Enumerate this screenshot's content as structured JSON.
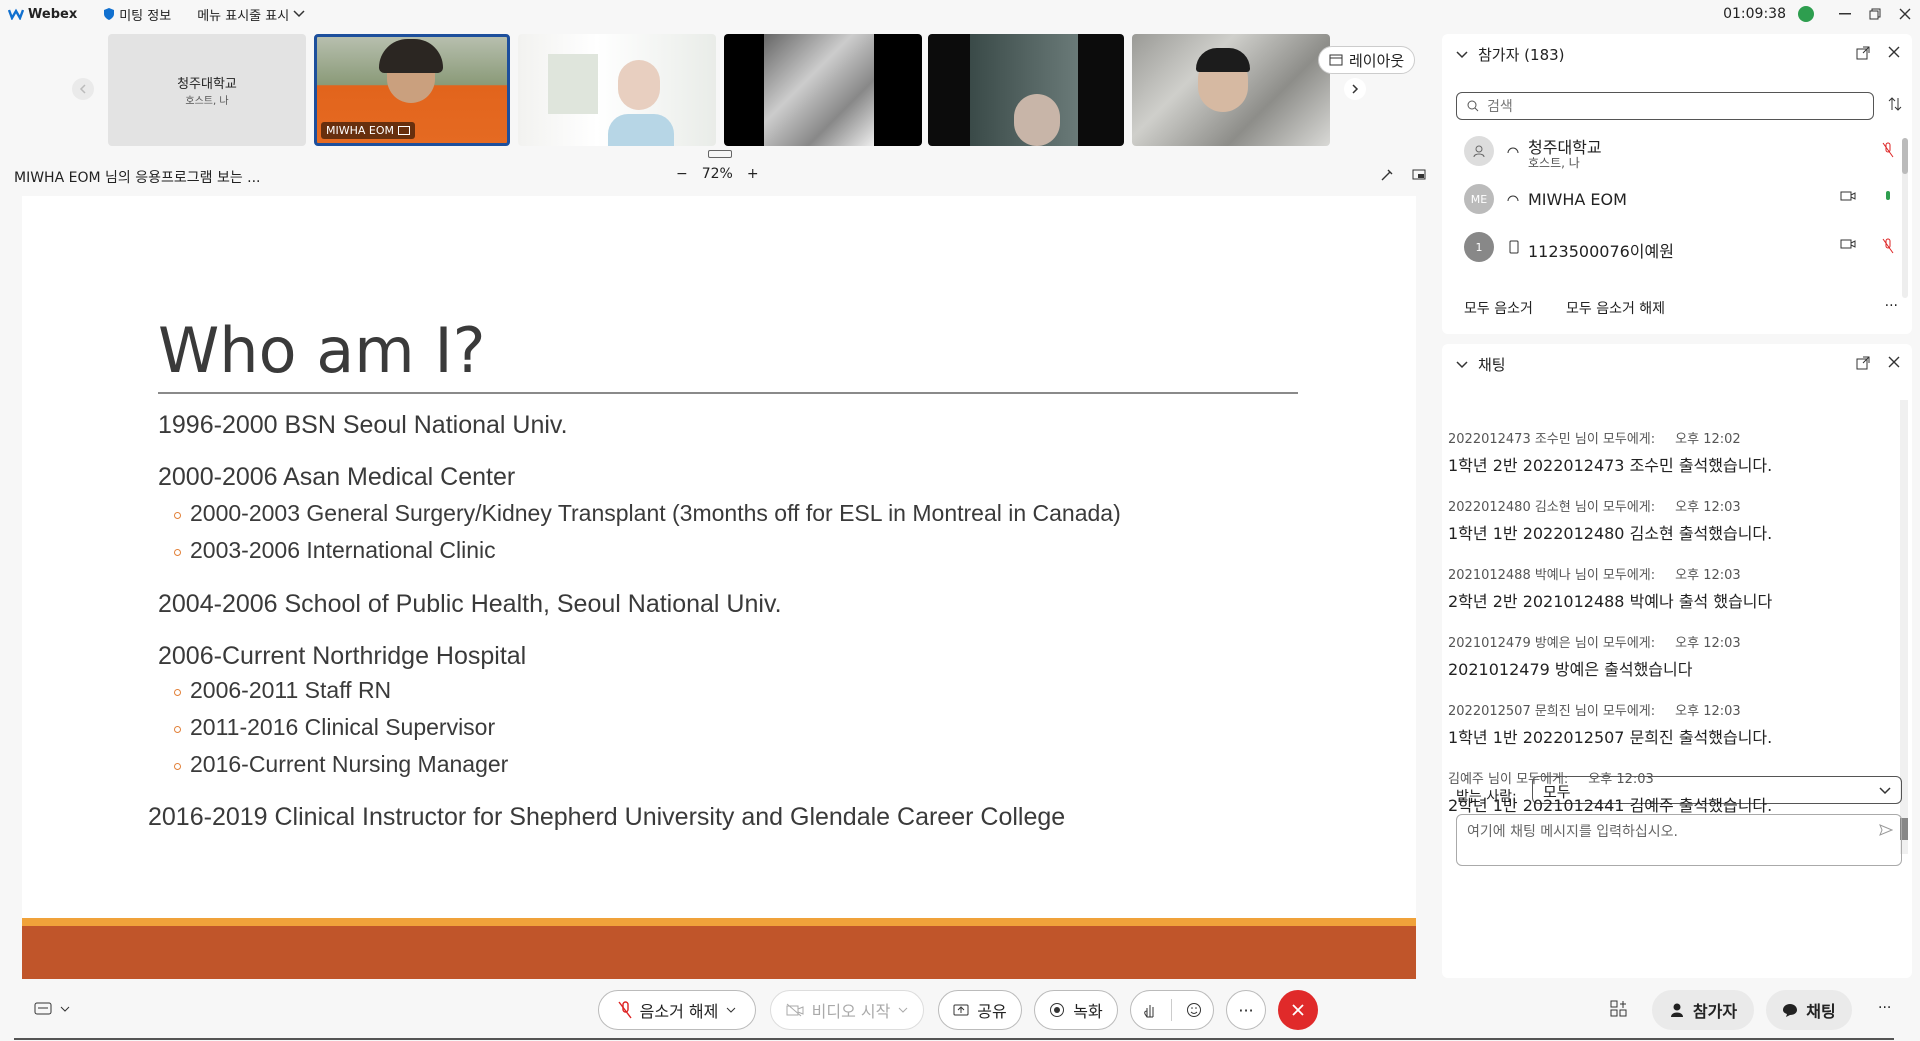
{
  "app": {
    "name": "Webex",
    "meeting_info": "미팅 정보",
    "menu_toggle": "메뉴 표시줄 표시",
    "time": "01:09:38"
  },
  "thumbnails": [
    {
      "title": "청주대학교",
      "subtitle": "호스트, 나"
    },
    {
      "label": "MIWHA EOM"
    },
    {
      "label": ""
    },
    {
      "label": ""
    },
    {
      "label": ""
    },
    {
      "label": ""
    }
  ],
  "layout_button": "레이아웃",
  "share": {
    "title": "MIWHA EOM 님의 응용프로그램 보는 ...",
    "zoom": "72%"
  },
  "slide": {
    "title": "Who am I?",
    "lines": [
      "1996-2000 BSN Seoul National Univ.",
      "2000-2006 Asan Medical Center",
      "2000-2003 General Surgery/Kidney Transplant (3months off for ESL in Montreal in Canada)",
      "2003-2006 International Clinic",
      "2004-2006 School of Public Health, Seoul National Univ.",
      "2006-Current Northridge Hospital",
      "2006-2011 Staff RN",
      "2011-2016 Clinical Supervisor",
      "2016-Current Nursing Manager",
      "2016-2019 Clinical Instructor for Shepherd University and Glendale Career College"
    ]
  },
  "participants": {
    "header": "참가자 (183)",
    "search_placeholder": "검색",
    "list": [
      {
        "name": "청주대학교",
        "sub": "호스트, 나",
        "avatar": ""
      },
      {
        "name": "MIWHA EOM",
        "avatar": "ME"
      },
      {
        "name": "1123500076이예원",
        "avatar": "1"
      }
    ],
    "mute_all": "모두 음소거",
    "unmute_all": "모두 음소거 해제"
  },
  "chat": {
    "header": "채팅",
    "messages": [
      {
        "meta": "2022012473 조수민 님이 모두에게:",
        "time": "오후 12:02",
        "text": "1학년 2반 2022012473 조수민 출석했습니다."
      },
      {
        "meta": "2022012480 김소현 님이 모두에게:",
        "time": "오후 12:03",
        "text": "1학년 1반 2022012480 김소현 출석했습니다."
      },
      {
        "meta": "2021012488 박예나 님이 모두에게:",
        "time": "오후 12:03",
        "text": "2학년 2반 2021012488 박예나 출석 했습니다"
      },
      {
        "meta": "2021012479 방예은 님이 모두에게:",
        "time": "오후 12:03",
        "text": "2021012479 방예은 출석했습니다"
      },
      {
        "meta": "2022012507 문희진 님이 모두에게:",
        "time": "오후 12:03",
        "text": "1학년 1반 2022012507 문희진 출석했습니다."
      },
      {
        "meta": "김예주 님이 모두에게:",
        "time": "오후 12:03",
        "text": "2학년 1반 2021012441 김예주 출석했습니다."
      }
    ],
    "to_label": "받는 사람:",
    "to_value": "모두",
    "input_placeholder": "여기에 채팅 메시지를 입력하십시오."
  },
  "toolbar": {
    "unmute": "음소거 해제",
    "video": "비디오 시작",
    "share": "공유",
    "record": "녹화",
    "participants": "참가자",
    "chat": "채팅"
  }
}
